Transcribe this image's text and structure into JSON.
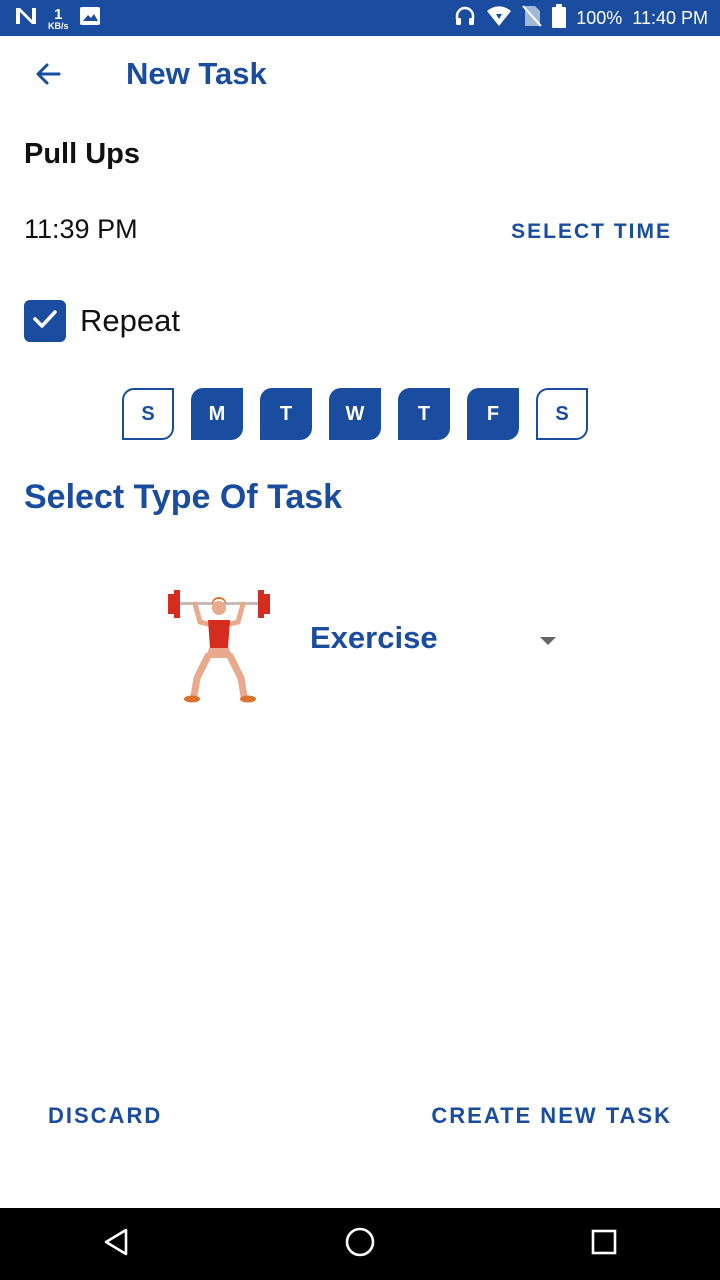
{
  "status_bar": {
    "net_speed": "1",
    "net_unit": "KB/s",
    "battery": "100%",
    "time": "11:40 PM",
    "icons": [
      "n-logo-icon",
      "image-icon",
      "headphones-icon",
      "wifi-icon",
      "no-sim-icon",
      "battery-icon"
    ]
  },
  "app_bar": {
    "title": "New Task",
    "back_icon": "arrow-back-icon"
  },
  "task": {
    "name": "Pull Ups",
    "time": "11:39 PM",
    "select_time_label": "SELECT TIME"
  },
  "repeat": {
    "label": "Repeat",
    "checked": true
  },
  "days": [
    {
      "label": "S",
      "selected": false
    },
    {
      "label": "M",
      "selected": true
    },
    {
      "label": "T",
      "selected": true
    },
    {
      "label": "W",
      "selected": true
    },
    {
      "label": "T",
      "selected": true
    },
    {
      "label": "F",
      "selected": true
    },
    {
      "label": "S",
      "selected": false
    }
  ],
  "task_type": {
    "section_title": "Select Type Of Task",
    "selected": "Exercise",
    "icon": "weightlifter-icon"
  },
  "actions": {
    "discard": "DISCARD",
    "create": "CREATE NEW TASK"
  },
  "nav_bar": {
    "icons": [
      "back-triangle-icon",
      "home-circle-icon",
      "recents-square-icon"
    ]
  },
  "colors": {
    "primary": "#1a4d9f",
    "status_bar": "#1a4d9f",
    "nav_bar": "#000000"
  }
}
